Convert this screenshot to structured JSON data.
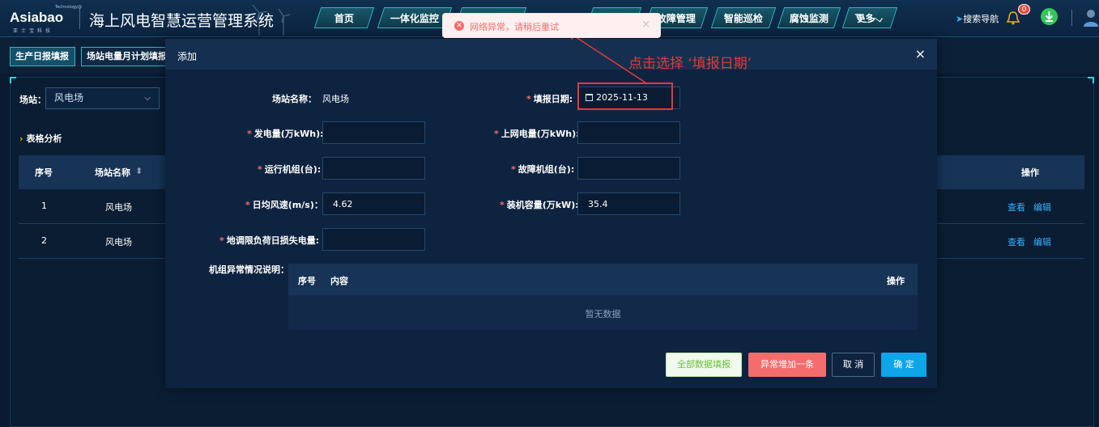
{
  "header": {
    "logo_main": "Asiabao",
    "logo_tech": "Technology@",
    "logo_cn": "亚士宝科技",
    "title": "海上风电智慧运营管理系统",
    "nav": [
      "首页",
      "一体化监控",
      "故障管理",
      "智能巡检",
      "腐蚀监测",
      "更多"
    ],
    "search_nav": "搜索导航",
    "bell_count": "0"
  },
  "subtabs": [
    "生产日报填报",
    "场站电量月计划填报"
  ],
  "page": {
    "station_label": "场站：",
    "station_value": "风电场",
    "section_title": "表格分析",
    "table_headers": {
      "index": "序号",
      "station_name": "场站名称",
      "actions": "操作"
    },
    "rows": [
      {
        "index": "1",
        "station": "风电场",
        "view": "查看",
        "edit": "编辑"
      },
      {
        "index": "2",
        "station": "风电场",
        "view": "查看",
        "edit": "编辑"
      }
    ]
  },
  "modal": {
    "title": "添加",
    "close": "×",
    "station_label": "场站名称：",
    "station_value": "风电场",
    "date_label": "填报日期:",
    "date_value": "2025-11-13",
    "gen_label": "发电量(万kWh):",
    "grid_label": "上网电量(万kWh):",
    "running_label": "运行机组(台):",
    "fault_label": "故障机组(台):",
    "wind_label": "日均风速(m/s)：",
    "wind_value": "4.62",
    "capacity_label": "装机容量(万kW):",
    "capacity_value": "35.4",
    "loss_label": "地调限负荷日损失电量:",
    "anomaly_label": "机组异常情况说明：",
    "inner_headers": {
      "index": "序号",
      "content": "内容",
      "actions": "操作"
    },
    "empty_text": "暂无数据",
    "btn_fill_all": "全部数据填报",
    "btn_add_anomaly": "异常增加一条",
    "btn_cancel": "取 消",
    "btn_ok": "确 定"
  },
  "toast": {
    "message": "网络异常，请稍后重试",
    "close": "×"
  },
  "annotation": "点击选择 ‘填报日期’",
  "colors": {
    "accent": "#2fb7c6",
    "link": "#36b2ff",
    "danger": "#e53935",
    "primary_btn": "#0ea5e9"
  }
}
